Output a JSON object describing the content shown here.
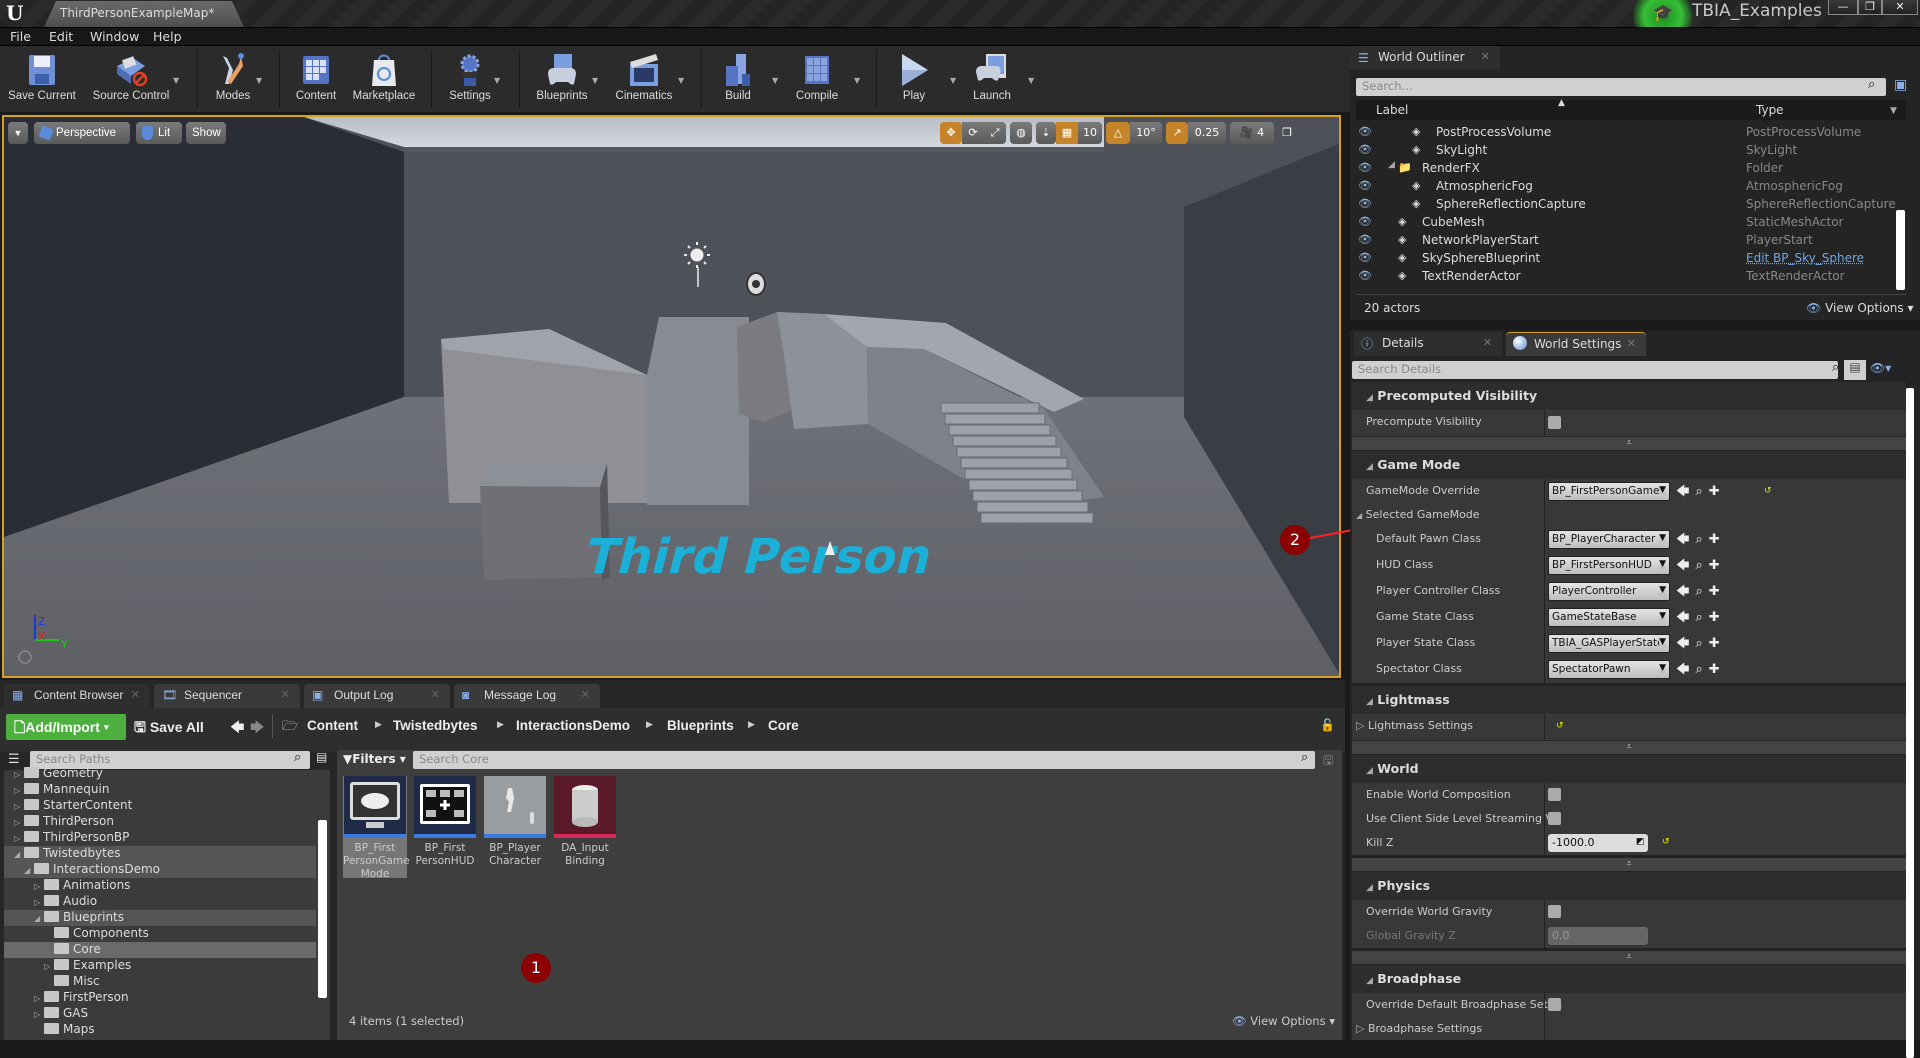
{
  "window": {
    "app_logo": "U",
    "map_tab": "ThirdPersonExampleMap*",
    "project_name": "TBIA_Examples",
    "controls": {
      "minimize": "—",
      "restore": "❐",
      "close": "✕"
    }
  },
  "menu": [
    "File",
    "Edit",
    "Window",
    "Help"
  ],
  "toolbar": [
    {
      "label": "Save Current",
      "icon": "save-icon"
    },
    {
      "label": "Source Control",
      "icon": "source-control-icon"
    },
    {
      "label": "Modes",
      "icon": "modes-icon"
    },
    {
      "label": "Content",
      "icon": "content-icon"
    },
    {
      "label": "Marketplace",
      "icon": "marketplace-icon"
    },
    {
      "label": "Settings",
      "icon": "settings-icon"
    },
    {
      "label": "Blueprints",
      "icon": "blueprints-icon"
    },
    {
      "label": "Cinematics",
      "icon": "cinematics-icon"
    },
    {
      "label": "Build",
      "icon": "build-icon"
    },
    {
      "label": "Compile",
      "icon": "compile-icon"
    },
    {
      "label": "Play",
      "icon": "play-icon"
    },
    {
      "label": "Launch",
      "icon": "launch-icon"
    }
  ],
  "viewport": {
    "view_mode": "Perspective",
    "lighting": "Lit",
    "show": "Show",
    "grid_snap": "10",
    "rotation_snap": "10°",
    "scale_snap": "0.25",
    "camera_speed": "4",
    "scene_text": "Third Person",
    "axes": {
      "z": "Z",
      "x": "X",
      "y": "Y"
    }
  },
  "outliner": {
    "tab": "World Outliner",
    "search_placeholder": "Search...",
    "col_label": "Label",
    "col_type": "Type",
    "rows": [
      {
        "label": "PostProcessVolume",
        "type": "PostProcessVolume",
        "indent": 2
      },
      {
        "label": "SkyLight",
        "type": "SkyLight",
        "indent": 2
      },
      {
        "label": "RenderFX",
        "type": "Folder",
        "indent": 1,
        "folder": true
      },
      {
        "label": "AtmosphericFog",
        "type": "AtmosphericFog",
        "indent": 2
      },
      {
        "label": "SphereReflectionCapture",
        "type": "SphereReflectionCapture",
        "indent": 2
      },
      {
        "label": "CubeMesh",
        "type": "StaticMeshActor",
        "indent": 1
      },
      {
        "label": "NetworkPlayerStart",
        "type": "PlayerStart",
        "indent": 1
      },
      {
        "label": "SkySphereBlueprint",
        "type": "Edit BP_Sky_Sphere",
        "indent": 1,
        "link": true
      },
      {
        "label": "TextRenderActor",
        "type": "TextRenderActor",
        "indent": 1
      }
    ],
    "count": "20 actors",
    "view_options": "View Options"
  },
  "details": {
    "tabs": [
      "Details",
      "World Settings"
    ],
    "search_placeholder": "Search Details",
    "sections": {
      "precomputed": {
        "title": "Precomputed Visibility",
        "precompute_visibility": "Precompute Visibility"
      },
      "gamemode": {
        "title": "Game Mode",
        "override_label": "GameMode Override",
        "override_value": "BP_FirstPersonGame",
        "selected": "Selected GameMode",
        "rows": [
          {
            "label": "Default Pawn Class",
            "value": "BP_PlayerCharacter"
          },
          {
            "label": "HUD Class",
            "value": "BP_FirstPersonHUD"
          },
          {
            "label": "Player Controller Class",
            "value": "PlayerController"
          },
          {
            "label": "Game State Class",
            "value": "GameStateBase"
          },
          {
            "label": "Player State Class",
            "value": "TBIA_GASPlayerState"
          },
          {
            "label": "Spectator Class",
            "value": "SpectatorPawn"
          }
        ]
      },
      "lightmass": {
        "title": "Lightmass",
        "settings": "Lightmass Settings"
      },
      "world": {
        "title": "World",
        "enable_world_composition": "Enable World Composition",
        "client_side_streaming": "Use Client Side Level Streaming Vo",
        "kill_z_label": "Kill Z",
        "kill_z_value": "-1000.0"
      },
      "physics": {
        "title": "Physics",
        "override_gravity": "Override World Gravity",
        "global_gravity_label": "Global Gravity Z",
        "global_gravity_value": "0.0"
      },
      "broadphase": {
        "title": "Broadphase",
        "override_default": "Override Default Broadphase Settin",
        "settings": "Broadphase Settings"
      }
    }
  },
  "bottom": {
    "tabs": [
      "Content Browser",
      "Sequencer",
      "Output Log",
      "Message Log"
    ],
    "add_import": "Add/Import",
    "save_all": "Save All",
    "breadcrumb": [
      "Content",
      "Twistedbytes",
      "InteractionsDemo",
      "Blueprints",
      "Core"
    ],
    "search_paths_placeholder": "Search Paths",
    "filters": "Filters",
    "search_core_placeholder": "Search Core",
    "tree": [
      {
        "label": "Geometry",
        "depth": 0,
        "arrow": "▷"
      },
      {
        "label": "Mannequin",
        "depth": 0,
        "arrow": "▷"
      },
      {
        "label": "StarterContent",
        "depth": 0,
        "arrow": "▷"
      },
      {
        "label": "ThirdPerson",
        "depth": 0,
        "arrow": "▷"
      },
      {
        "label": "ThirdPersonBP",
        "depth": 0,
        "arrow": "▷"
      },
      {
        "label": "Twistedbytes",
        "depth": 0,
        "arrow": "◢",
        "state": "sel"
      },
      {
        "label": "InteractionsDemo",
        "depth": 1,
        "arrow": "◢",
        "state": "sel"
      },
      {
        "label": "Animations",
        "depth": 2,
        "arrow": "▷"
      },
      {
        "label": "Audio",
        "depth": 2,
        "arrow": "▷"
      },
      {
        "label": "Blueprints",
        "depth": 2,
        "arrow": "◢",
        "state": "sel"
      },
      {
        "label": "Components",
        "depth": 3,
        "arrow": ""
      },
      {
        "label": "Core",
        "depth": 3,
        "arrow": "",
        "state": "cur"
      },
      {
        "label": "Examples",
        "depth": 3,
        "arrow": "▷"
      },
      {
        "label": "Misc",
        "depth": 3,
        "arrow": ""
      },
      {
        "label": "FirstPerson",
        "depth": 2,
        "arrow": "▷"
      },
      {
        "label": "GAS",
        "depth": 2,
        "arrow": "▷"
      },
      {
        "label": "Maps",
        "depth": 2,
        "arrow": ""
      }
    ],
    "assets": [
      {
        "name": "BP_First PersonGame Mode",
        "selected": true
      },
      {
        "name": "BP_First PersonHUD"
      },
      {
        "name": "BP_Player Character"
      },
      {
        "name": "DA_Input Binding"
      }
    ],
    "status": "4 items (1 selected)",
    "view_options": "View Options"
  },
  "annotations": [
    "1",
    "2"
  ],
  "colors": {
    "accent_orange": "#d7a01d",
    "annotation_red": "#8b0000",
    "arrow_red": "#ff2020",
    "text_cyan": "#1ab0d8",
    "link_blue": "#6ea6e8"
  }
}
